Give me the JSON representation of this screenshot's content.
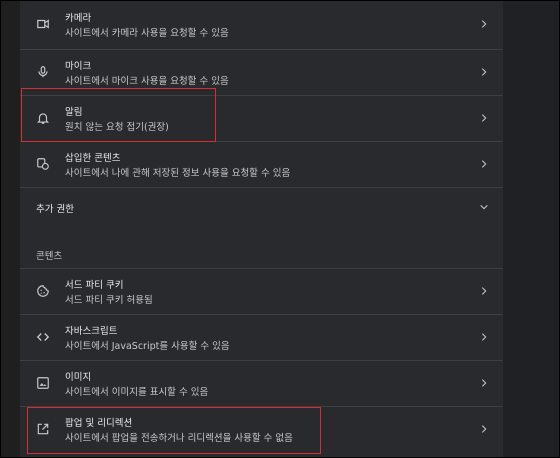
{
  "permissions": {
    "camera": {
      "title": "카메라",
      "description": "사이트에서 카메라 사용을 요청할 수 있음",
      "icon": "camera-icon"
    },
    "microphone": {
      "title": "마이크",
      "description": "사이트에서 마이크 사용을 요청할 수 있음",
      "icon": "microphone-icon"
    },
    "notifications": {
      "title": "알림",
      "description": "원치 않는 요청 접기(권장)",
      "icon": "bell-icon"
    },
    "embedded_content": {
      "title": "삽입한 콘텐츠",
      "description": "사이트에서 나에 관해 저장된 정보 사용을 요청할 수 있음",
      "icon": "embedded-content-icon"
    },
    "additional_permissions": {
      "label": "추가 권한",
      "icon": "chevron-down-icon"
    }
  },
  "content": {
    "heading": "콘텐츠",
    "third_party_cookies": {
      "title": "서드 파티 쿠키",
      "description": "서드 파티 쿠키 허용됨",
      "icon": "cookie-icon"
    },
    "javascript": {
      "title": "자바스크립트",
      "description": "사이트에서 JavaScript를 사용할 수 있음",
      "icon": "code-icon"
    },
    "images": {
      "title": "이미지",
      "description": "사이트에서 이미지를 표시할 수 있음",
      "icon": "image-icon"
    },
    "popups": {
      "title": "팝업 및 리디렉션",
      "description": "사이트에서 팝업을 전송하거나 리디렉션을 사용할 수 없음",
      "icon": "open-in-new-icon"
    }
  },
  "colors": {
    "panel_bg": "#292a2d",
    "page_bg": "#1f1f1f",
    "text_primary": "#e8eaed",
    "text_secondary": "#c6c9cc",
    "divider": "#3c4043",
    "highlight": "#d32f2f"
  }
}
